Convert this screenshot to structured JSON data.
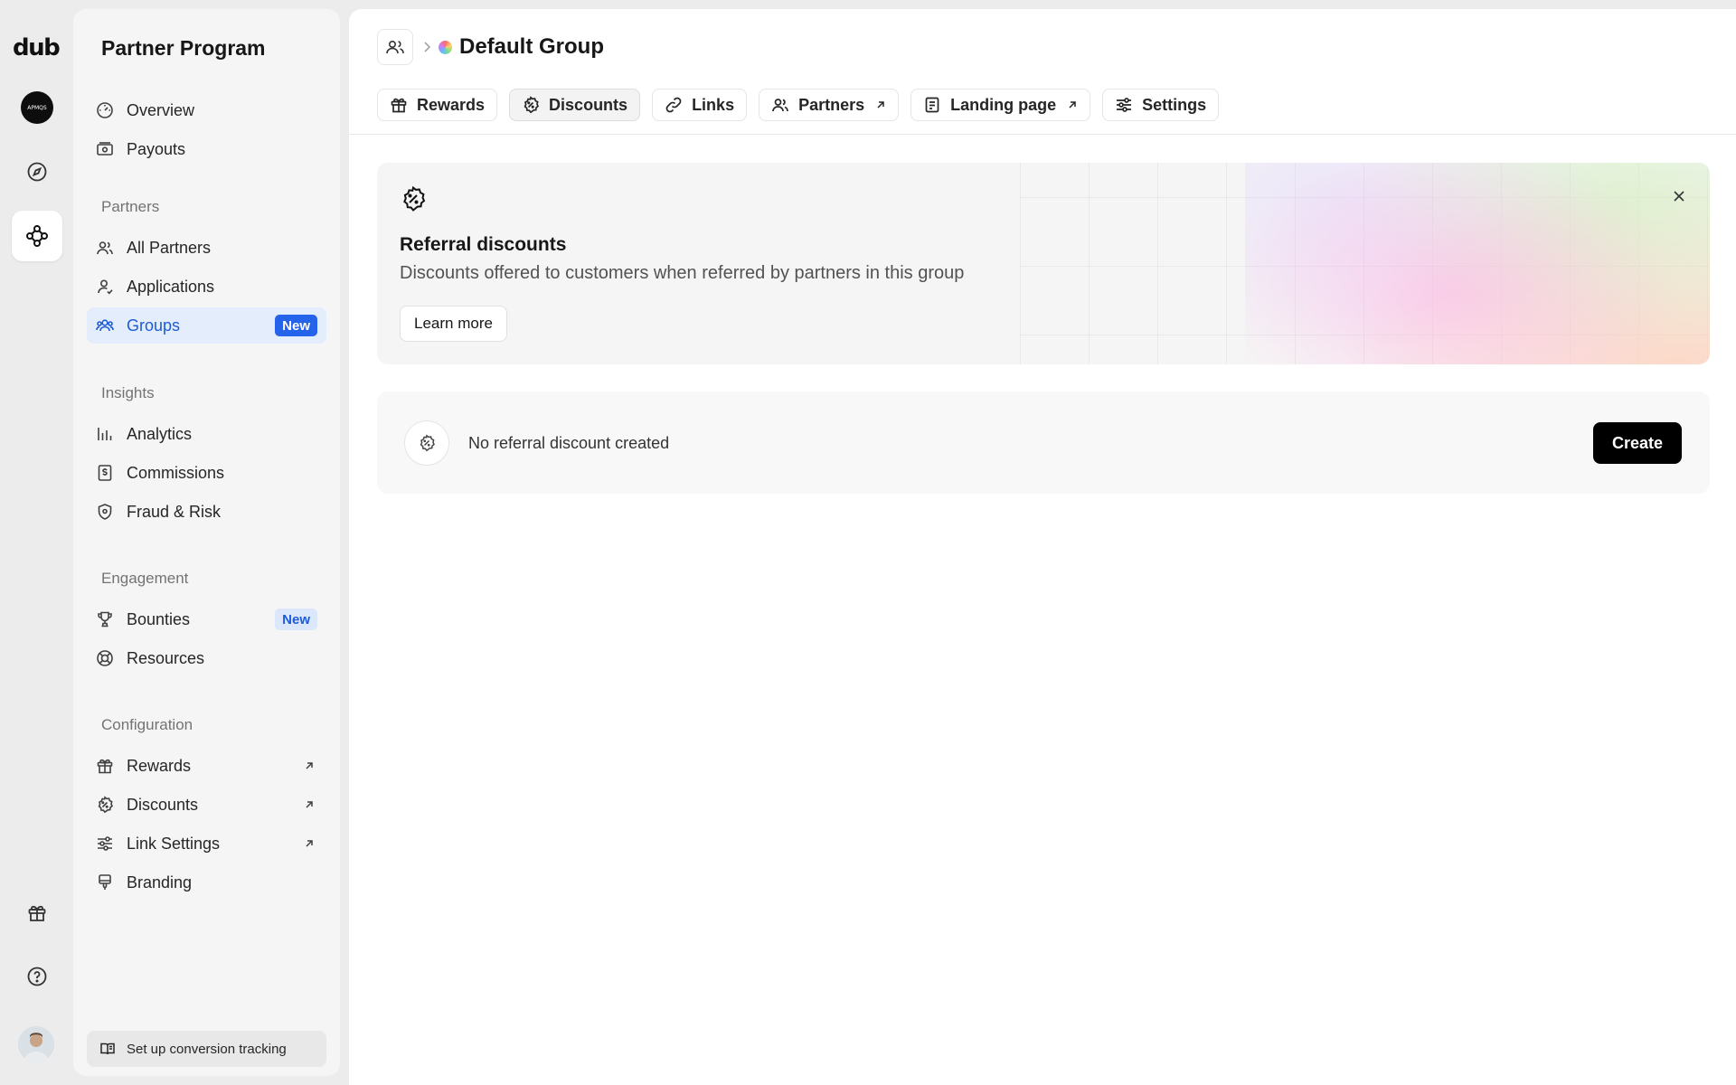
{
  "rail": {
    "logo": "dub",
    "workspace_avatar_text": "APMQS"
  },
  "sidebar": {
    "title": "Partner Program",
    "overview": "Overview",
    "payouts": "Payouts",
    "partners_section": "Partners",
    "all_partners": "All Partners",
    "applications": "Applications",
    "groups": "Groups",
    "groups_badge": "New",
    "insights_section": "Insights",
    "analytics": "Analytics",
    "commissions": "Commissions",
    "fraud_risk": "Fraud & Risk",
    "engagement_section": "Engagement",
    "bounties": "Bounties",
    "bounties_badge": "New",
    "resources": "Resources",
    "configuration_section": "Configuration",
    "rewards": "Rewards",
    "discounts": "Discounts",
    "link_settings": "Link Settings",
    "branding": "Branding",
    "footer_cta": "Set up conversion tracking"
  },
  "header": {
    "group_name": "Default Group"
  },
  "tabs": {
    "rewards": "Rewards",
    "discounts": "Discounts",
    "links": "Links",
    "partners": "Partners",
    "landing_page": "Landing page",
    "settings": "Settings",
    "active": "discounts"
  },
  "hero": {
    "title": "Referral discounts",
    "description": "Discounts offered to customers when referred by partners in this group",
    "button": "Learn more"
  },
  "empty_state": {
    "message": "No referral discount created",
    "button": "Create"
  },
  "colors": {
    "accent": "#2563eb",
    "active_bg": "#e3edfb",
    "primary_button": "#000000"
  }
}
